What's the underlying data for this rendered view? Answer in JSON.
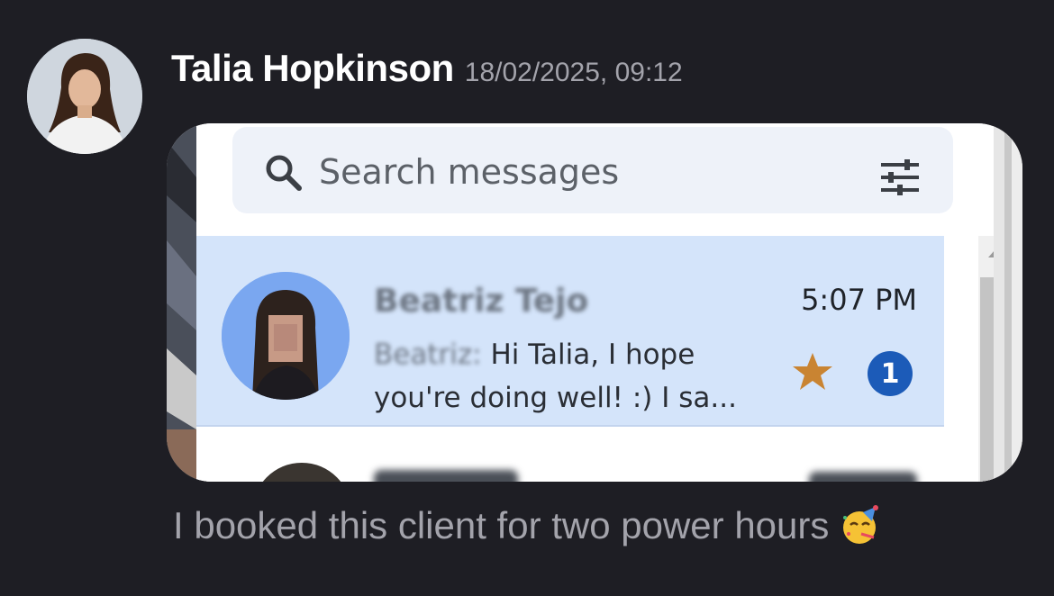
{
  "message": {
    "sender_name": "Talia Hopkinson",
    "timestamp": "18/02/2025, 09:12",
    "caption": "I booked this client for two power hours",
    "caption_emoji_icon": "partying-face-icon"
  },
  "attachment": {
    "search": {
      "placeholder": "Search messages",
      "icon": "search-icon",
      "filter_icon": "sliders-icon"
    },
    "selected_conversation": {
      "name": "Beatriz Tejo",
      "time": "5:07 PM",
      "preview_sender": "Beatriz:",
      "preview_text": "Hi Talia, I hope you're doing well! :) I sa...",
      "unread_count": "1",
      "starred": true
    }
  },
  "colors": {
    "background": "#1e1e24",
    "selected_row": "#d4e4fa",
    "badge": "#1c5bb8",
    "star": "#c98432"
  }
}
